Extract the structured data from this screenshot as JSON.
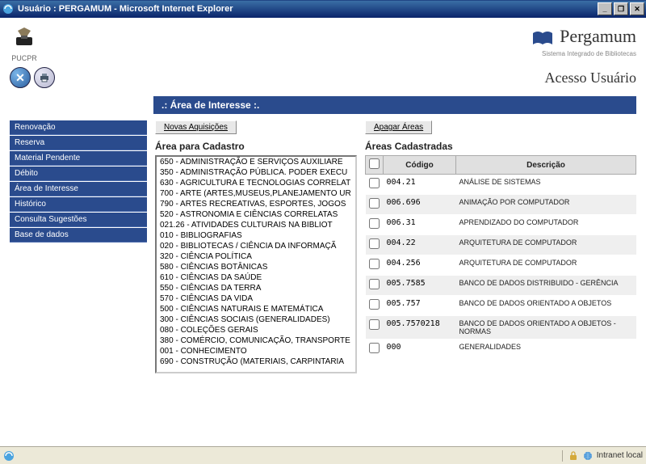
{
  "window": {
    "title": "Usuário : PERGAMUM - Microsoft Internet Explorer"
  },
  "header": {
    "pucpr_label": "PUCPR",
    "brand": "Pergamum",
    "brand_sub": "Sistema Integrado de Bibliotecas",
    "access_label": "Acesso Usuário"
  },
  "section_title": ".: Área de Interesse :.",
  "sidebar": {
    "items": [
      {
        "label": "Renovação"
      },
      {
        "label": "Reserva"
      },
      {
        "label": "Material Pendente"
      },
      {
        "label": "Débito"
      },
      {
        "label": "Área de Interesse"
      },
      {
        "label": "Histórico"
      },
      {
        "label": "Consulta Sugestões"
      },
      {
        "label": "Base de dados"
      }
    ]
  },
  "middle": {
    "button_label": "Novas Aquisições",
    "title": "Área para Cadastro",
    "items": [
      "650 - ADMINISTRAÇÃO E SERVIÇOS AUXILIARE",
      "350 - ADMINISTRAÇÃO PÚBLICA. PODER EXECU",
      "630 - AGRICULTURA E TECNOLOGIAS CORRELAT",
      "700 - ARTE (ARTES,MUSEUS,PLANEJAMENTO UR",
      "790 - ARTES RECREATIVAS, ESPORTES, JOGOS",
      "520 - ASTRONOMIA E CIÊNCIAS CORRELATAS",
      "021.26 - ATIVIDADES CULTURAIS NA BIBLIOT",
      "010 - BIBLIOGRAFIAS",
      "020 - BIBLIOTECAS / CIÊNCIA DA INFORMAÇÃ",
      "320 - CIÊNCIA POLÍTICA",
      "580 - CIÊNCIAS BOTÂNICAS",
      "610 - CIÊNCIAS DA SAÚDE",
      "550 - CIÊNCIAS DA TERRA",
      "570 - CIÊNCIAS DA VIDA",
      "500 - CIÊNCIAS NATURAIS E MATEMÁTICA",
      "300 - CIÊNCIAS SOCIAIS (GENERALIDADES)",
      "080 - COLEÇÕES GERAIS",
      "380 - COMÉRCIO, COMUNICAÇÃO, TRANSPORTE",
      "001 - CONHECIMENTO",
      "690 - CONSTRUÇÃO (MATERIAIS, CARPINTARIA"
    ]
  },
  "right": {
    "button_label": "Apagar Áreas",
    "title": "Áreas Cadastradas",
    "th_code": "Código",
    "th_desc": "Descrição",
    "rows": [
      {
        "code": "004.21",
        "desc": "ANÁLISE DE SISTEMAS"
      },
      {
        "code": "006.696",
        "desc": "ANIMAÇÃO POR COMPUTADOR"
      },
      {
        "code": "006.31",
        "desc": "APRENDIZADO DO COMPUTADOR"
      },
      {
        "code": "004.22",
        "desc": "ARQUITETURA DE COMPUTADOR"
      },
      {
        "code": "004.256",
        "desc": "ARQUITETURA DE COMPUTADOR"
      },
      {
        "code": "005.7585",
        "desc": "BANCO DE DADOS DISTRIBUIDO - GERÊNCIA"
      },
      {
        "code": "005.757",
        "desc": "BANCO DE DADOS ORIENTADO A OBJETOS"
      },
      {
        "code": "005.7570218",
        "desc": "BANCO DE DADOS ORIENTADO A OBJETOS - NORMAS"
      },
      {
        "code": "000",
        "desc": "GENERALIDADES"
      }
    ]
  },
  "statusbar": {
    "zone": "Intranet local"
  }
}
